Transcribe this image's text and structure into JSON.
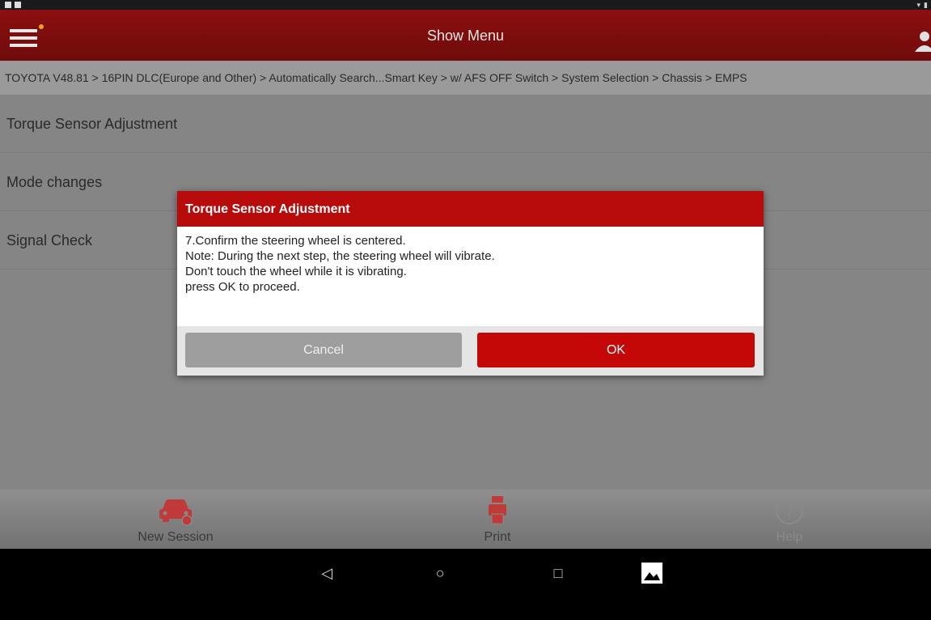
{
  "header": {
    "title": "Show Menu",
    "menu_icon": "hamburger-menu-icon",
    "user_icon": "user-icon"
  },
  "breadcrumb": {
    "text": "TOYOTA V48.81 > 16PIN DLC(Europe and Other) > Automatically Search...Smart Key > w/ AFS OFF Switch > System Selection > Chassis > EMPS"
  },
  "menu_items": [
    {
      "label": "Torque Sensor Adjustment"
    },
    {
      "label": "Mode changes"
    },
    {
      "label": "Signal Check"
    }
  ],
  "dialog": {
    "title": "Torque Sensor Adjustment",
    "lines": [
      "7.Confirm the steering wheel is centered.",
      "Note: During the next step, the steering wheel will vibrate.",
      "Don't touch the wheel while it is vibrating.",
      "press OK to proceed."
    ],
    "cancel_label": "Cancel",
    "ok_label": "OK"
  },
  "bottom_nav": [
    {
      "label": "New Session",
      "icon": "car-icon"
    },
    {
      "label": "Print",
      "icon": "printer-icon"
    },
    {
      "label": "Help",
      "icon": "info-icon"
    }
  ],
  "android_nav": {
    "back": "◁",
    "home": "○",
    "recents": "□",
    "gallery_icon": "gallery-icon"
  },
  "colors": {
    "brand_red": "#b80b0b",
    "header_red": "#8c0f0f",
    "ok_red": "#c40808",
    "cancel_gray": "#9e9e9e"
  }
}
